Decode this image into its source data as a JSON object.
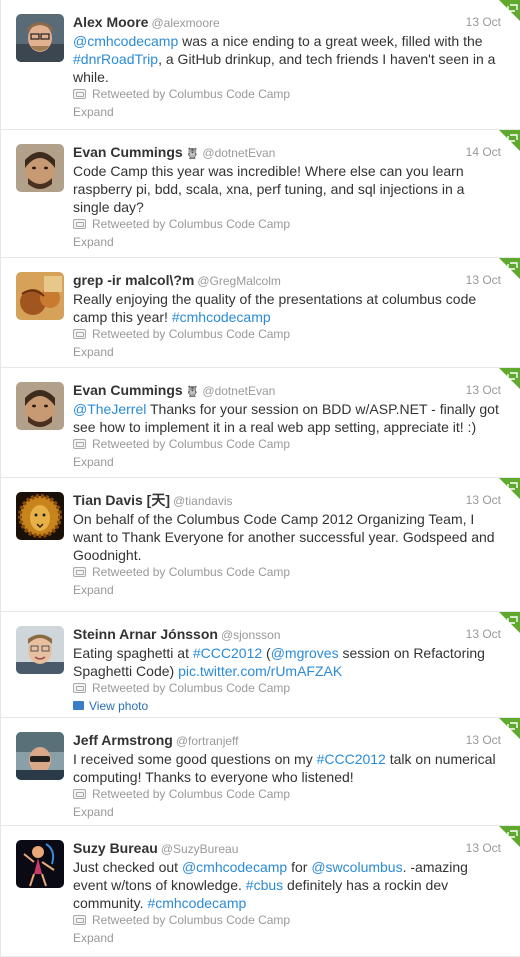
{
  "accent_link_color": "#2a8bd8",
  "corner_color": "#5fa92e",
  "tweets": [
    {
      "fullname": "Alex Moore",
      "username": "@alexmoore",
      "time": "13 Oct",
      "text_parts": [
        {
          "t": "@cmhcodecamp",
          "link": true
        },
        {
          "t": " was a nice ending to a great week, filled with the ",
          "link": false
        },
        {
          "t": "#dnrRoadTrip",
          "link": true
        },
        {
          "t": ", a GitHub drinkup, and tech friends I haven't seen in a while.",
          "link": false
        }
      ],
      "context": "Retweeted by Columbus Code Camp",
      "expand": "Expand",
      "avatar": "alex-moore-avatar"
    },
    {
      "fullname": "Evan Cummings",
      "owl": true,
      "username": "@dotnetEvan",
      "time": "14 Oct",
      "text_parts": [
        {
          "t": "Code Camp this year was incredible! Where else can you learn raspberry pi, bdd, scala, xna, perf tuning, and sql injections in a single day?",
          "link": false
        }
      ],
      "context": "Retweeted by Columbus Code Camp",
      "expand": "Expand",
      "avatar": "evan-cummings-avatar"
    },
    {
      "fullname": "grep -ir malcol\\?m",
      "username": "@GregMalcolm",
      "time": "13 Oct",
      "text_parts": [
        {
          "t": "Really enjoying the quality of the presentations at columbus code camp this year! ",
          "link": false
        },
        {
          "t": "#cmhcodecamp",
          "link": true
        }
      ],
      "context": "Retweeted by Columbus Code Camp",
      "expand": "Expand",
      "avatar": "greg-malcolm-avatar"
    },
    {
      "fullname": "Evan Cummings",
      "owl": true,
      "username": "@dotnetEvan",
      "time": "13 Oct",
      "text_parts": [
        {
          "t": "@TheJerrel",
          "link": true
        },
        {
          "t": " Thanks for your session on BDD w/ASP.NET - finally got see how to implement it in a real web app setting, appreciate it! :)",
          "link": false
        }
      ],
      "context": "Retweeted by Columbus Code Camp",
      "expand": "Expand",
      "avatar": "evan-cummings-avatar"
    },
    {
      "fullname": "Tian Davis [天]",
      "username": "@tiandavis",
      "time": "13 Oct",
      "text_parts": [
        {
          "t": "On behalf of the Columbus Code Camp 2012 Organizing Team, I want to Thank Everyone for another successful year. Godspeed and Goodnight.",
          "link": false
        }
      ],
      "context": "Retweeted by Columbus Code Camp",
      "expand": "Expand",
      "avatar": "tian-davis-avatar"
    },
    {
      "fullname": "Steinn Arnar Jónsson",
      "username": "@sjonsson",
      "time": "13 Oct",
      "text_parts": [
        {
          "t": "Eating spaghetti at ",
          "link": false
        },
        {
          "t": "#CCC2012",
          "link": true
        },
        {
          "t": " (",
          "link": false
        },
        {
          "t": "@mgroves",
          "link": true
        },
        {
          "t": " session on Refactoring Spaghetti Code) ",
          "link": false
        },
        {
          "t": "pic.twitter.com/rUmAFZAK",
          "link": true
        }
      ],
      "context": "Retweeted by Columbus Code Camp",
      "expand": "View photo",
      "is_photo": true,
      "avatar": "steinn-jonsson-avatar"
    },
    {
      "fullname": "Jeff Armstrong",
      "username": "@fortranjeff",
      "time": "13 Oct",
      "text_parts": [
        {
          "t": "I received some good questions on my ",
          "link": false
        },
        {
          "t": "#CCC2012",
          "link": true
        },
        {
          "t": " talk on numerical computing! Thanks to everyone who listened!",
          "link": false
        }
      ],
      "context": "Retweeted by Columbus Code Camp",
      "expand": "Expand",
      "avatar": "jeff-armstrong-avatar"
    },
    {
      "fullname": "Suzy Bureau",
      "username": "@SuzyBureau",
      "time": "13 Oct",
      "text_parts": [
        {
          "t": "Just checked out ",
          "link": false
        },
        {
          "t": "@cmhcodecamp",
          "link": true
        },
        {
          "t": " for ",
          "link": false
        },
        {
          "t": "@swcolumbus",
          "link": true
        },
        {
          "t": ". -amazing event w/tons of knowledge. ",
          "link": false
        },
        {
          "t": "#cbus",
          "link": true
        },
        {
          "t": " definitely has a rockin dev community. ",
          "link": false
        },
        {
          "t": "#cmhcodecamp",
          "link": true
        }
      ],
      "context": "Retweeted by Columbus Code Camp",
      "expand": "Expand",
      "avatar": "suzy-bureau-avatar"
    }
  ]
}
